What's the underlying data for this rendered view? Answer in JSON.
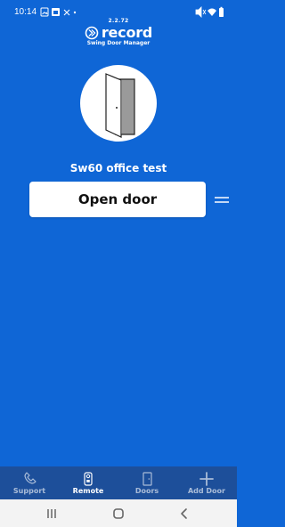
{
  "status_bar": {
    "time": "10:14"
  },
  "app": {
    "version": "2.2.72",
    "brand_name": "record",
    "subtitle": "Swing Door Manager"
  },
  "door": {
    "name": "Sw60 office test",
    "open_button_label": "Open door"
  },
  "bottom_nav": {
    "items": [
      {
        "label": "Support",
        "icon": "phone-icon",
        "active": false
      },
      {
        "label": "Remote",
        "icon": "remote-icon",
        "active": true
      },
      {
        "label": "Doors",
        "icon": "door-icon",
        "active": false
      },
      {
        "label": "Add Door",
        "icon": "plus-icon",
        "active": false
      }
    ]
  },
  "colors": {
    "background": "#0f66d6",
    "bottom_nav_background": "#1d4f9a",
    "button_background": "#ffffff",
    "door_icon_gray": "#9a9a9a"
  }
}
